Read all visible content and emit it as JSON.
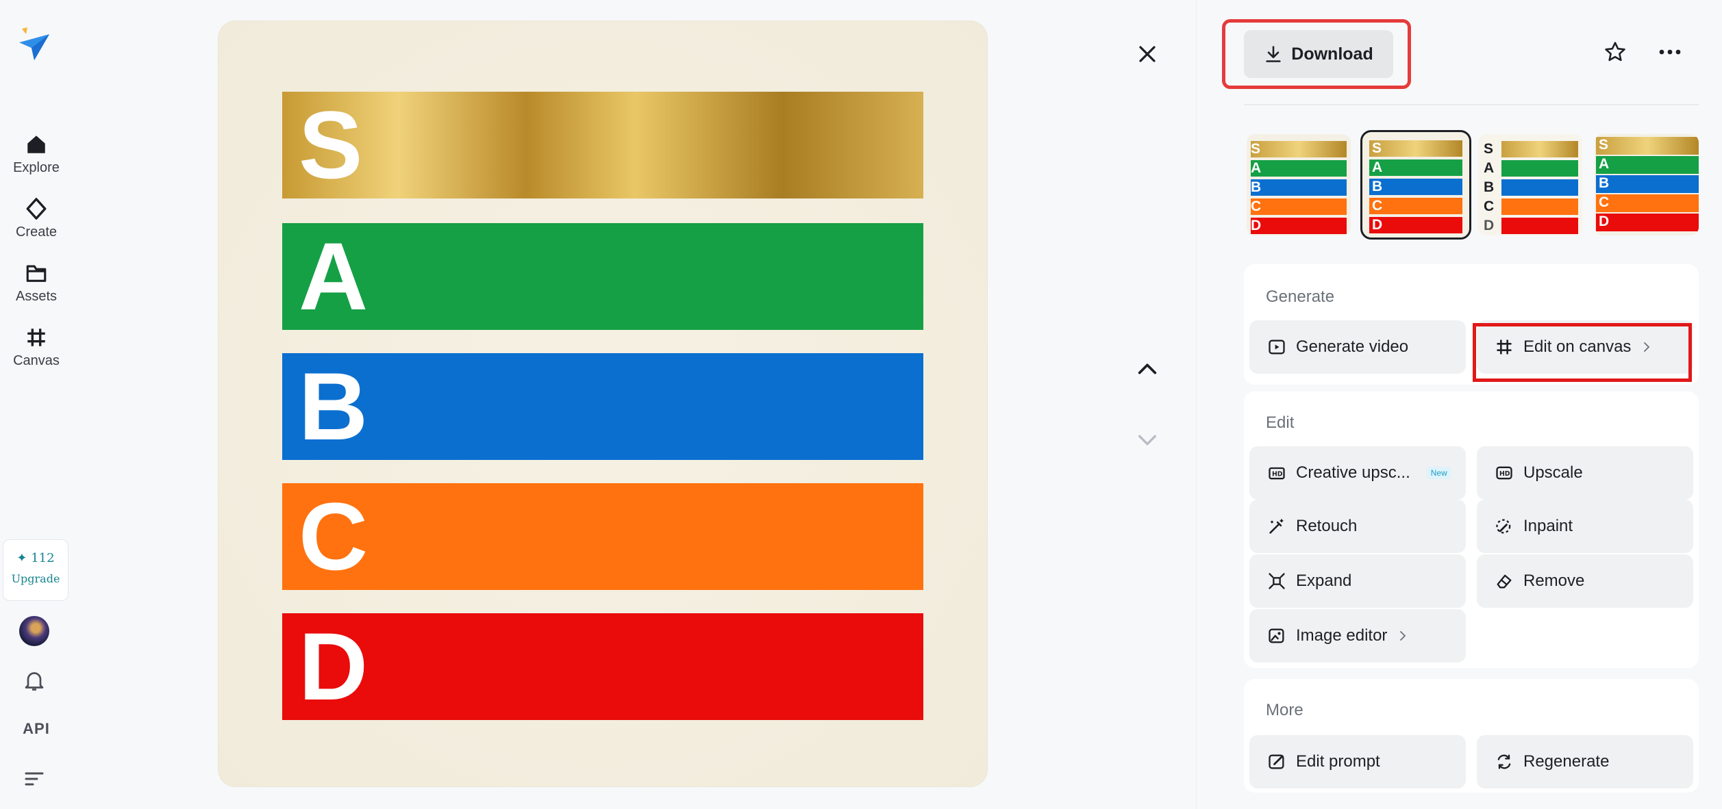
{
  "sidebar": {
    "items": [
      {
        "label": "Explore",
        "icon": "home-icon"
      },
      {
        "label": "Create",
        "icon": "sparkle-diamond-icon"
      },
      {
        "label": "Assets",
        "icon": "folder-icon"
      },
      {
        "label": "Canvas",
        "icon": "canvas-grid-icon"
      }
    ],
    "credits": {
      "count": "✦ 112",
      "label": "Upgrade"
    },
    "api_label": "API"
  },
  "image": {
    "tiers": [
      {
        "letter": "S",
        "color": "#c9a040"
      },
      {
        "letter": "A",
        "color": "#15a046"
      },
      {
        "letter": "B",
        "color": "#0b6fd0"
      },
      {
        "letter": "C",
        "color": "#ff720f"
      },
      {
        "letter": "D",
        "color": "#ea0b0b"
      }
    ]
  },
  "toolbar": {
    "download_label": "Download"
  },
  "thumbnails": {
    "selected_index": 1,
    "count": 4
  },
  "generate": {
    "heading": "Generate",
    "generate_video": "Generate video",
    "edit_on_canvas": "Edit on canvas"
  },
  "edit": {
    "heading": "Edit",
    "creative_upscale": "Creative upsc...",
    "new_badge": "New",
    "upscale": "Upscale",
    "retouch": "Retouch",
    "inpaint": "Inpaint",
    "expand": "Expand",
    "remove": "Remove",
    "image_editor": "Image editor"
  },
  "more": {
    "heading": "More",
    "edit_prompt": "Edit prompt",
    "regenerate": "Regenerate"
  },
  "colors": {
    "highlight": "#e11919",
    "accent": "#17838f"
  }
}
